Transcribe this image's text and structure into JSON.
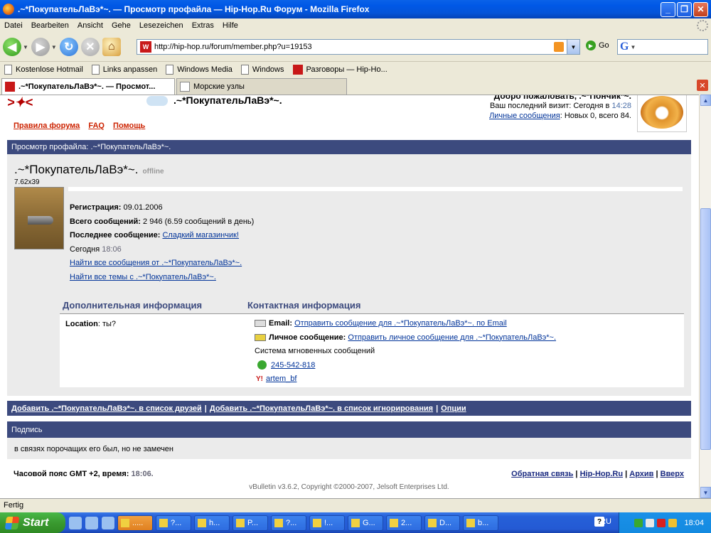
{
  "window": {
    "title": ".~*ПокупательЛаВэ*~. — Просмотр профайла — Hip-Hop.Ru Форум - Mozilla Firefox"
  },
  "menu": [
    "Datei",
    "Bearbeiten",
    "Ansicht",
    "Gehe",
    "Lesezeichen",
    "Extras",
    "Hilfe"
  ],
  "nav": {
    "url": "http://hip-hop.ru/forum/member.php?u=19153",
    "go_label": "Go",
    "search_letter": "G"
  },
  "bookmarks": [
    {
      "label": "Kostenlose Hotmail",
      "icon": "document-icon"
    },
    {
      "label": "Links anpassen",
      "icon": "document-icon"
    },
    {
      "label": "Windows Media",
      "icon": "document-icon"
    },
    {
      "label": "Windows",
      "icon": "document-icon"
    },
    {
      "label": "Разговоры — Hip-Ho...",
      "icon": "hiphop-icon"
    }
  ],
  "tabs": [
    {
      "label": ".~*ПокупательЛаВэ*~. — Просмот...",
      "active": true
    },
    {
      "label": "Морские узлы",
      "active": false
    }
  ],
  "header": {
    "username": ".~*ПокупательЛаВэ*~.",
    "welcome_line": "Добро пожаловать, .~*Пончик*~.",
    "last_visit_label": "Ваш последний визит: Сегодня в",
    "last_visit_time": "14:28",
    "pm_link": "Личные сообщения",
    "pm_counts": ": Новых 0, всего 84.",
    "links": [
      "Правила форума",
      "FAQ",
      "Помощь"
    ]
  },
  "breadcrumb": "Просмотр профайла: .~*ПокупательЛаВэ*~.",
  "profile": {
    "name": ".~*ПокупательЛаВэ*~.",
    "status": "offline",
    "title": "7.62x39",
    "reg_label": "Регистрация:",
    "reg_value": "09.01.2006",
    "posts_label": "Всего сообщений:",
    "posts_value": "2 946 (6.59 сообщений в день)",
    "last_post_label": "Последнее сообщение:",
    "last_post_link": "Сладкий магазинчик!",
    "today_label": "Сегодня",
    "today_time": "18:06",
    "find_posts": "Найти все сообщения от .~*ПокупательЛаВэ*~.",
    "find_threads": "Найти все темы с .~*ПокупательЛаВэ*~."
  },
  "additional": {
    "heading": "Дополнительная информация",
    "location_label": "Location",
    "location_value": ": ты?"
  },
  "contact": {
    "heading": "Контактная информация",
    "email_label": "Email:",
    "email_link": "Отправить сообщение для .~*ПокупательЛаВэ*~. по Email",
    "pm_label": "Личное сообщение:",
    "pm_link": "Отправить личное сообщение для .~*ПокупательЛаВэ*~.",
    "im_label": "Система мгновенных сообщений",
    "icq": "245-542-818",
    "yahoo": "artem_bf"
  },
  "actions": {
    "add_friend": "Добавить .~*ПокупательЛаВэ*~. в список друзей",
    "add_ignore": "Добавить .~*ПокупательЛаВэ*~. в список игнорирования",
    "options": "Опции"
  },
  "signature": {
    "heading": "Подпись",
    "text": "в связях порочащих его был, но не замечен"
  },
  "footer": {
    "tz_label": "Часовой пояс GMT +2, время:",
    "tz_time": "18:06.",
    "links": [
      "Обратная связь",
      "Hip-Hop.Ru",
      "Архив",
      "Вверх"
    ],
    "vb": "vBulletin v3.6.2, Copyright ©2000-2007, Jelsoft Enterprises Ltd."
  },
  "statusbar": "Fertig",
  "taskbar": {
    "start": "Start",
    "buttons": [
      ".....",
      "?...",
      "h...",
      "P...",
      "?...",
      "!...",
      "G...",
      "2...",
      "D...",
      "b..."
    ],
    "active_index": 0,
    "lang": "RU",
    "clock": "18:04"
  }
}
